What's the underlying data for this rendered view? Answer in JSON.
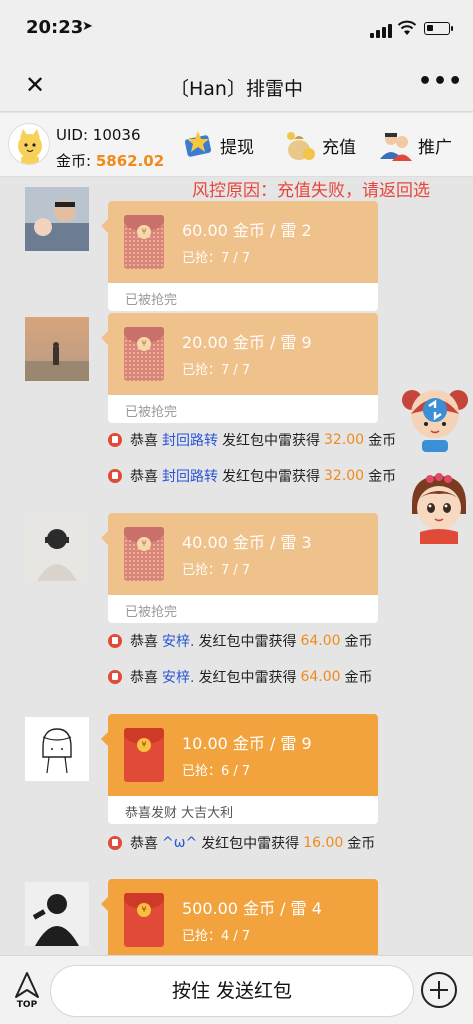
{
  "status": {
    "time": "20:23"
  },
  "nav": {
    "close_label": "✕",
    "title": "〔Han〕排雷中",
    "more_label": "•••"
  },
  "account": {
    "uid_label": "UID:",
    "uid": "10036",
    "coins_label": "金币:",
    "coins": "5862.02",
    "withdraw": "提现",
    "recharge": "充值",
    "promote": "推广"
  },
  "notice": "风控原因：充值失败，请返回选",
  "messages": [
    {
      "amount": "60.00 金币 / 雷 2",
      "grabbed": "已抢：7 / 7",
      "footer": "已被抢完",
      "state": "done"
    },
    {
      "amount": "20.00 金币 / 雷 9",
      "grabbed": "已抢：7 / 7",
      "footer": "已被抢完",
      "state": "done"
    },
    {
      "amount": "40.00 金币 / 雷 3",
      "grabbed": "已抢：7 / 7",
      "footer": "已被抢完",
      "state": "done"
    },
    {
      "amount": "10.00 金币 / 雷 9",
      "grabbed": "已抢：6 / 7",
      "footer": "恭喜发财 大吉大利",
      "state": "open"
    },
    {
      "amount": "500.00 金币 / 雷 4",
      "grabbed": "已抢：4 / 7",
      "footer": "",
      "state": "open"
    }
  ],
  "system": [
    {
      "prefix": "恭喜",
      "name": "封回路转",
      "middle": "发红包中雷获得",
      "won": "32.00",
      "suffix": "金币"
    },
    {
      "prefix": "恭喜",
      "name": "封回路转",
      "middle": "发红包中雷获得",
      "won": "32.00",
      "suffix": "金币"
    },
    {
      "prefix": "恭喜",
      "name": "安梓.",
      "middle": "发红包中雷获得",
      "won": "64.00",
      "suffix": "金币"
    },
    {
      "prefix": "恭喜",
      "name": "安梓.",
      "middle": "发红包中雷获得",
      "won": "64.00",
      "suffix": "金币"
    },
    {
      "prefix": "恭喜",
      "name": "^ω^",
      "middle": "发红包中雷获得",
      "won": "16.00",
      "suffix": "金币"
    }
  ],
  "bottom": {
    "top_label": "TOP",
    "send_label": "按住 发送红包"
  },
  "colors": {
    "accent": "#f08a1c",
    "link": "#2a56d6",
    "alert": "#e8453c"
  }
}
